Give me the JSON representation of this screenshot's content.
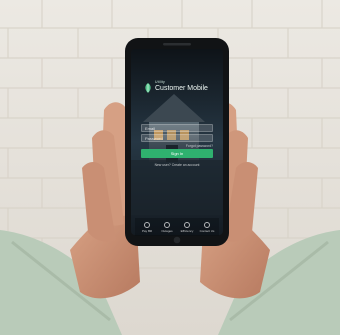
{
  "app": {
    "brand_small": "Utility",
    "brand_title": "Customer Mobile",
    "email_placeholder": "Email",
    "password_placeholder": "Password",
    "forgot_link": "Forgot password?",
    "signin_label": "Sign In",
    "secondary_link": "New user? Create an account",
    "nav_items": [
      "Pay Bill",
      "Outages",
      "Efficiency",
      "Contact Us"
    ]
  },
  "colors": {
    "accent": "#2fb16f",
    "background": "#e9e6e0"
  },
  "icons": [
    "leaf-icon",
    "pay-bill-icon",
    "outages-icon",
    "efficiency-icon",
    "contact-icon"
  ]
}
